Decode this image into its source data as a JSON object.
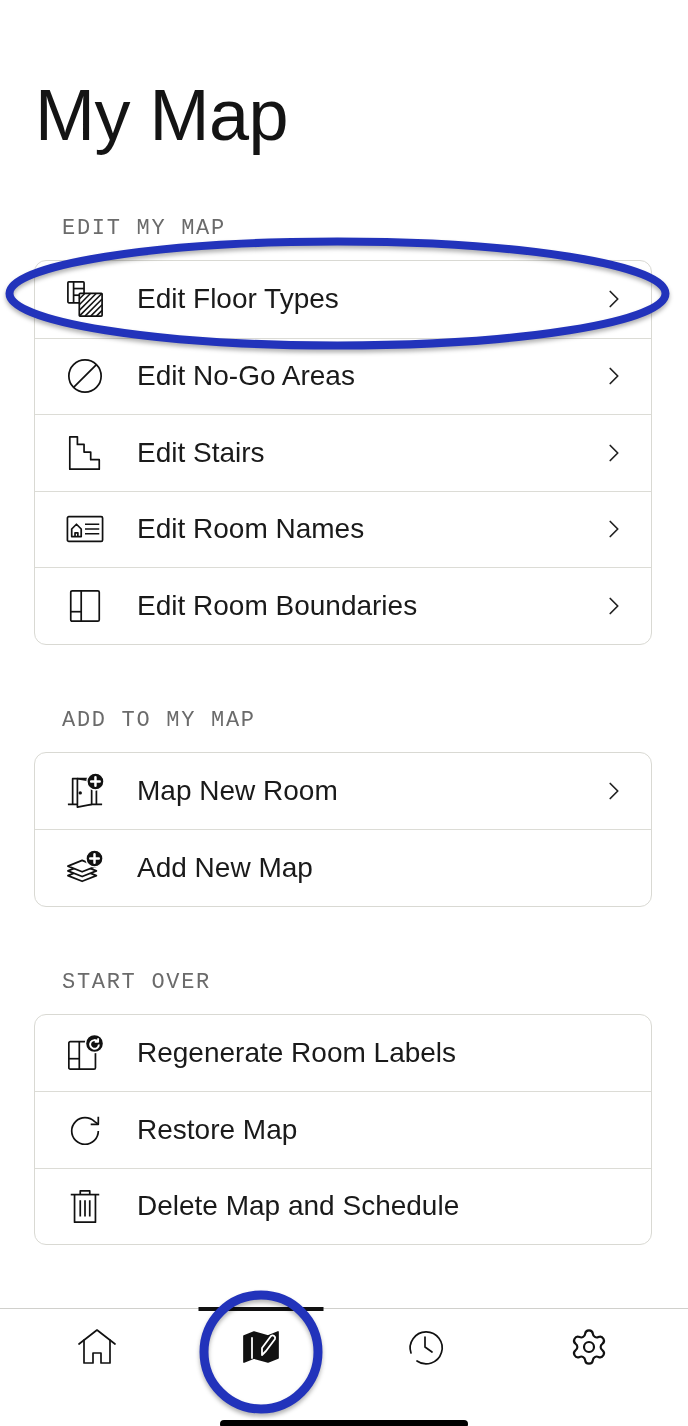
{
  "title": "My Map",
  "sections": [
    {
      "header": "EDIT MY MAP",
      "items": [
        {
          "label": "Edit Floor Types",
          "chevron": true,
          "highlighted": true
        },
        {
          "label": "Edit No-Go Areas",
          "chevron": true,
          "highlighted": false
        },
        {
          "label": "Edit Stairs",
          "chevron": true,
          "highlighted": false
        },
        {
          "label": "Edit Room Names",
          "chevron": true,
          "highlighted": false
        },
        {
          "label": "Edit Room Boundaries",
          "chevron": true,
          "highlighted": false
        }
      ]
    },
    {
      "header": "ADD TO MY MAP",
      "items": [
        {
          "label": "Map New Room",
          "chevron": true,
          "highlighted": false
        },
        {
          "label": "Add New Map",
          "chevron": false,
          "highlighted": false
        }
      ]
    },
    {
      "header": "START OVER",
      "items": [
        {
          "label": "Regenerate Room Labels",
          "chevron": false,
          "highlighted": false
        },
        {
          "label": "Restore Map",
          "chevron": false,
          "highlighted": false
        },
        {
          "label": "Delete Map and Schedule",
          "chevron": false,
          "highlighted": false
        }
      ]
    }
  ],
  "tab_bar": {
    "tabs": [
      {
        "selected": false,
        "highlighted": false
      },
      {
        "selected": true,
        "highlighted": true
      },
      {
        "selected": false,
        "highlighted": false
      },
      {
        "selected": false,
        "highlighted": false
      }
    ]
  }
}
